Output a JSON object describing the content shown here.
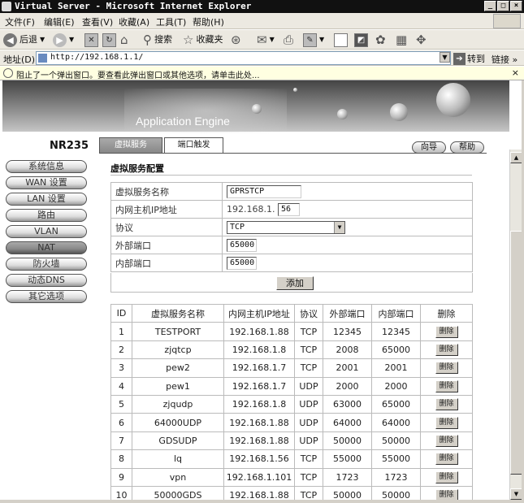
{
  "window": {
    "title": "Virtual Server - Microsoft Internet Explorer",
    "min": "_",
    "max": "□",
    "close": "×"
  },
  "menu": [
    "文件(F)",
    "编辑(E)",
    "查看(V)",
    "收藏(A)",
    "工具(T)",
    "帮助(H)"
  ],
  "toolbar": {
    "back": "后退",
    "search": "搜索",
    "favorites": "收藏夹"
  },
  "address": {
    "label": "地址(D)",
    "url": "http://192.168.1.1/",
    "go": "转到",
    "links": "链接 »"
  },
  "infobar": {
    "text": "阻止了一个弹出窗口。要查看此弹出窗口或其他选项，请单击此处...",
    "close": "×"
  },
  "banner": {
    "app_name": "Application Engine"
  },
  "device": {
    "model": "NR235"
  },
  "nav": [
    "系统信息",
    "WAN 设置",
    "LAN 设置",
    "路由",
    "VLAN",
    "NAT",
    "防火墙",
    "动态DNS",
    "其它选项"
  ],
  "tabs": [
    "虚拟服务",
    "端口触发"
  ],
  "pills": {
    "wizard": "向导",
    "help": "帮助"
  },
  "form": {
    "section_title": "虚拟服务配置",
    "name_label": "虚拟服务名称",
    "name_value": "GPRSTCP",
    "ip_label": "内网主机IP地址",
    "ip_prefix": "192.168.1.",
    "ip_value": "56",
    "proto_label": "协议",
    "proto_value": "TCP",
    "ext_label": "外部端口",
    "ext_value": "65000",
    "int_label": "内部端口",
    "int_value": "65000",
    "add_button": "添加"
  },
  "table": {
    "headers": [
      "ID",
      "虚拟服务名称",
      "内网主机IP地址",
      "协议",
      "外部端口",
      "内部端口",
      "删除"
    ],
    "delete_label": "删除",
    "rows": [
      [
        "1",
        "TESTPORT",
        "192.168.1.88",
        "TCP",
        "12345",
        "12345"
      ],
      [
        "2",
        "zjqtcp",
        "192.168.1.8",
        "TCP",
        "2008",
        "65000"
      ],
      [
        "3",
        "pew2",
        "192.168.1.7",
        "TCP",
        "2001",
        "2001"
      ],
      [
        "4",
        "pew1",
        "192.168.1.7",
        "UDP",
        "2000",
        "2000"
      ],
      [
        "5",
        "zjqudp",
        "192.168.1.8",
        "UDP",
        "63000",
        "65000"
      ],
      [
        "6",
        "64000UDP",
        "192.168.1.88",
        "UDP",
        "64000",
        "64000"
      ],
      [
        "7",
        "GDSUDP",
        "192.168.1.88",
        "UDP",
        "50000",
        "50000"
      ],
      [
        "8",
        "lq",
        "192.168.1.56",
        "TCP",
        "55000",
        "55000"
      ],
      [
        "9",
        "vpn",
        "192.168.1.101",
        "TCP",
        "1723",
        "1723"
      ],
      [
        "10",
        "50000GDS",
        "192.168.1.88",
        "TCP",
        "50000",
        "50000"
      ]
    ]
  }
}
